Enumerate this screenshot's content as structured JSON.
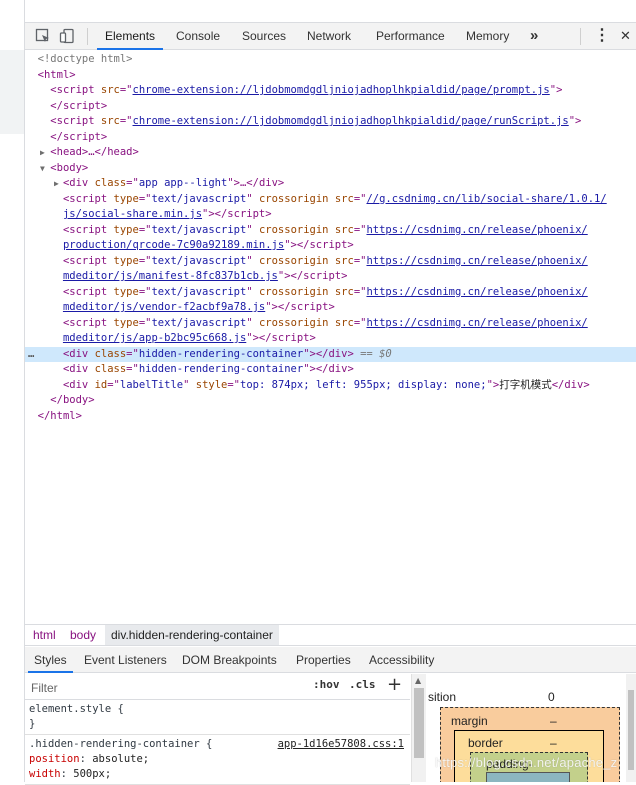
{
  "toolbar": {
    "tabs": [
      "Elements",
      "Console",
      "Sources",
      "Network",
      "Performance",
      "Memory"
    ],
    "more": "»",
    "menu": "⋮",
    "close": "✕"
  },
  "dom": {
    "doctype": "<!doctype html>",
    "html_open": "<html>",
    "script1_src": "chrome-extension://ljdobmomdgdljniojadhoplhkpialdid/page/prompt.js",
    "script2_src": "chrome-extension://ljdobmomdgdljniojadhoplhkpialdid/page/runScript.js",
    "head": "<head>…</head>",
    "body_open": "<body>",
    "app_class": "app app--light",
    "s1a": "//g.csdnimg.cn/lib/social-share/1.0.1/",
    "s1b": "js/social-share.min.js",
    "s2a": "https://csdnimg.cn/release/phoenix/",
    "s2b": "production/qrcode-7c90a92189.min.js",
    "s3a": "https://csdnimg.cn/release/phoenix/",
    "s3b": "mdeditor/js/manifest-8fc837b1cb.js",
    "s4a": "https://csdnimg.cn/release/phoenix/",
    "s4b": "mdeditor/js/vendor-f2acbf9a78.js",
    "s5a": "https://csdnimg.cn/release/phoenix/",
    "s5b": "mdeditor/js/app-b2bc95c668.js",
    "hidden_class": "hidden-rendering-container",
    "dollar0": "== $0",
    "label_id": "labelTitle",
    "label_style": "top: 874px; left: 955px; display: none;",
    "label_text": "打字机模式",
    "body_close": "</body>",
    "html_close": "</html>"
  },
  "breadcrumb": [
    "html",
    "body",
    "div.hidden-rendering-container"
  ],
  "subtabs": [
    "Styles",
    "Event Listeners",
    "DOM Breakpoints",
    "Properties",
    "Accessibility"
  ],
  "styles": {
    "filter_placeholder": "Filter",
    "hov": ":hov",
    "cls": ".cls",
    "plus": "+",
    "element_style": "element.style {",
    "close_brace": "}",
    "selector": ".hidden-rendering-container {",
    "source": "app-1d16e57808.css:1",
    "prop1": "position",
    "val1": "absolute;",
    "prop2": "width",
    "val2": "500px;"
  },
  "boxmodel": {
    "position_label": "sition",
    "position_value": "0",
    "margin_label": "margin",
    "margin_value": "–",
    "border_label": "border",
    "border_value": "–",
    "padding_label": "padding-"
  },
  "watermark": "https://blog.csdn.net/apache_z"
}
